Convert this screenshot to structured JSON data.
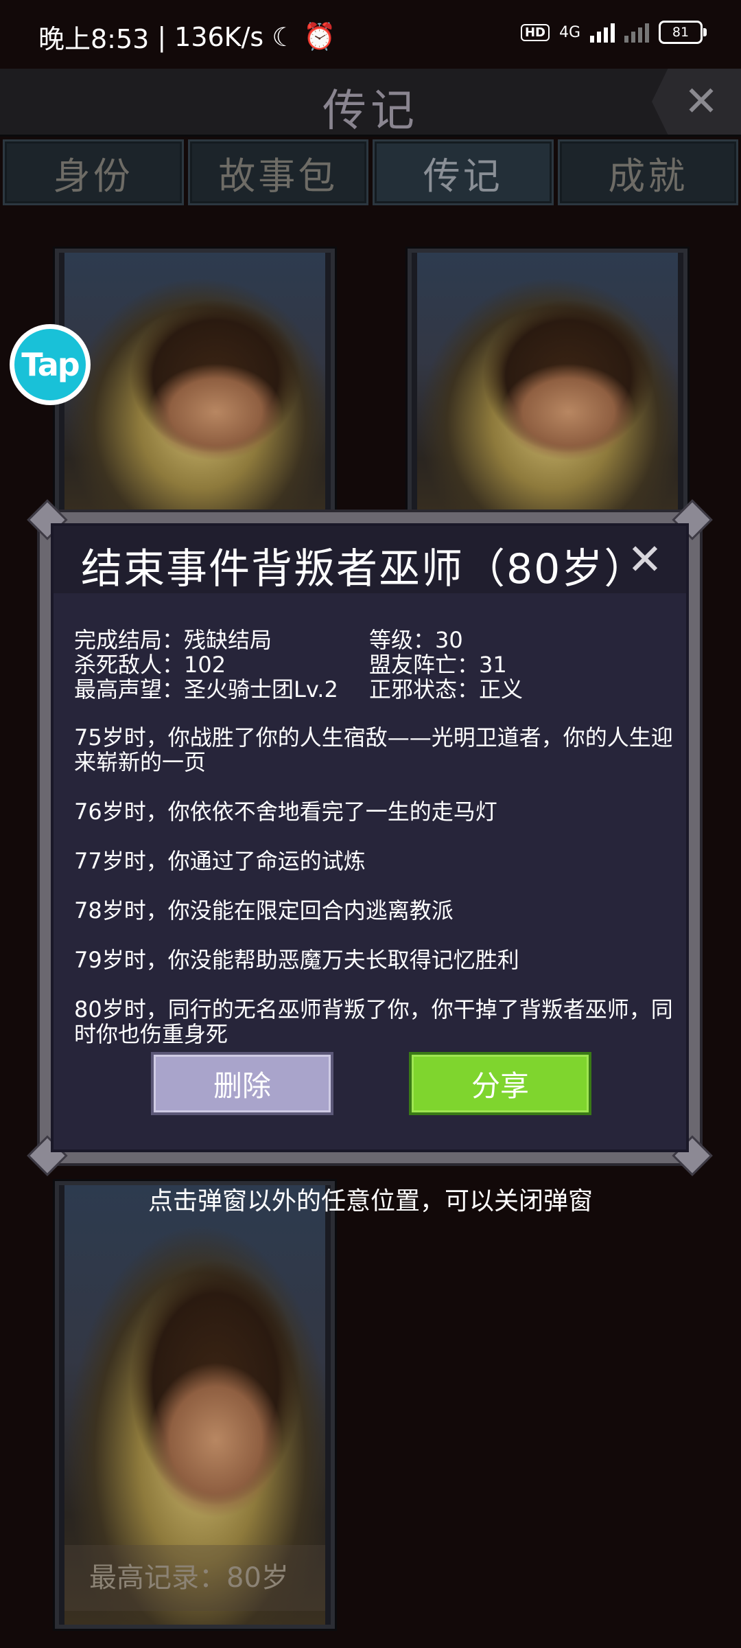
{
  "status_bar": {
    "time": "晚上8:53",
    "speed": "136K/s",
    "hd": "HD",
    "network": "4G",
    "battery": "81"
  },
  "header": {
    "title": "传记",
    "close": "✕"
  },
  "tabs": [
    {
      "label": "身份"
    },
    {
      "label": "故事包"
    },
    {
      "label": "传记"
    },
    {
      "label": "成就"
    }
  ],
  "tap_badge": "Tap",
  "dialog": {
    "title": "结束事件背叛者巫师（80岁）",
    "close": "✕",
    "stats": {
      "ending": "完成结局：残缺结局",
      "level": "等级：30",
      "kills": "杀死敌人：102",
      "allies_dead": "盟友阵亡：31",
      "reputation": "最高声望：圣火骑士团Lv.2",
      "alignment": "正邪状态：正义"
    },
    "events": [
      "75岁时，你战胜了你的人生宿敌——光明卫道者，你的人生迎来崭新的一页",
      "76岁时，你依依不舍地看完了一生的走马灯",
      "77岁时，你通过了命运的试炼",
      "78岁时，你没能在限定回合内逃离教派",
      "79岁时，你没能帮助恶魔万夫长取得记忆胜利",
      "80岁时，同行的无名巫师背叛了你，你干掉了背叛者巫师，同时你也伤重身死"
    ],
    "delete_label": "删除",
    "share_label": "分享"
  },
  "hint": "点击弹窗以外的任意位置，可以关闭弹窗",
  "card_caption": "最高记录：80岁"
}
